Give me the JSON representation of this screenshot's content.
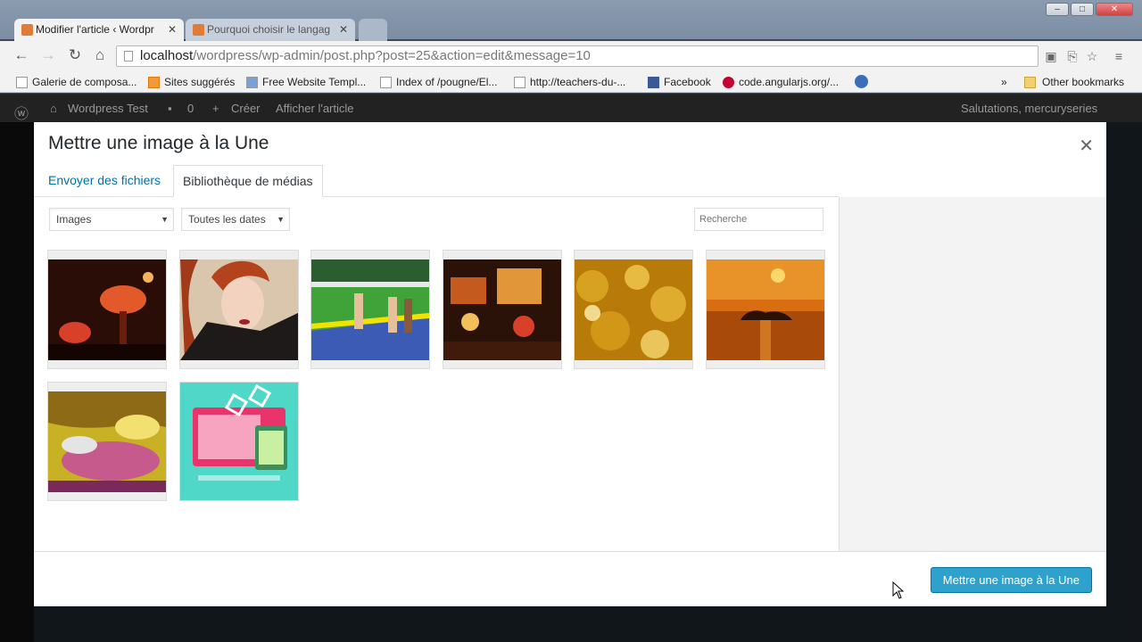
{
  "browser": {
    "tabs": [
      {
        "title": "Modifier l'article ‹ Wordpr",
        "active": true
      },
      {
        "title": "Pourquoi choisir le langag",
        "active": false
      }
    ],
    "url_host": "localhost",
    "url_path": "/wordpress/wp-admin/post.php?post=25&action=edit&message=10",
    "bookmarks": [
      "Galerie de composa...",
      "Sites suggérés",
      "Free Website Templ...",
      "Index of /pougne/El...",
      "http://teachers-du-...",
      "Facebook",
      "code.angularjs.org/..."
    ],
    "overflow_label": "»",
    "other_bookmarks": "Other bookmarks"
  },
  "wp": {
    "site_name": "Wordpress Test",
    "comments_count": "0",
    "new_label": "Créer",
    "view_post": "Afficher l'article",
    "greeting": "Salutations, mercuryseries"
  },
  "modal": {
    "title": "Mettre une image à la Une",
    "tabs": {
      "upload": "Envoyer des fichiers",
      "library": "Bibliothèque de médias"
    },
    "filter_type": "Images",
    "filter_date": "Toutes les dates",
    "search_placeholder": "Recherche",
    "primary_button": "Mettre une image à la Une"
  },
  "media": [
    {
      "name": "lamp-interior"
    },
    {
      "name": "woman-portrait"
    },
    {
      "name": "sprinters-race"
    },
    {
      "name": "night-market"
    },
    {
      "name": "golden-bokeh"
    },
    {
      "name": "sunset-island"
    },
    {
      "name": "abstract-paint"
    },
    {
      "name": "web-design-illustration"
    }
  ],
  "colors": {
    "accent": "#2ea2cc",
    "link": "#0073aa",
    "admin_bar": "#222222"
  }
}
